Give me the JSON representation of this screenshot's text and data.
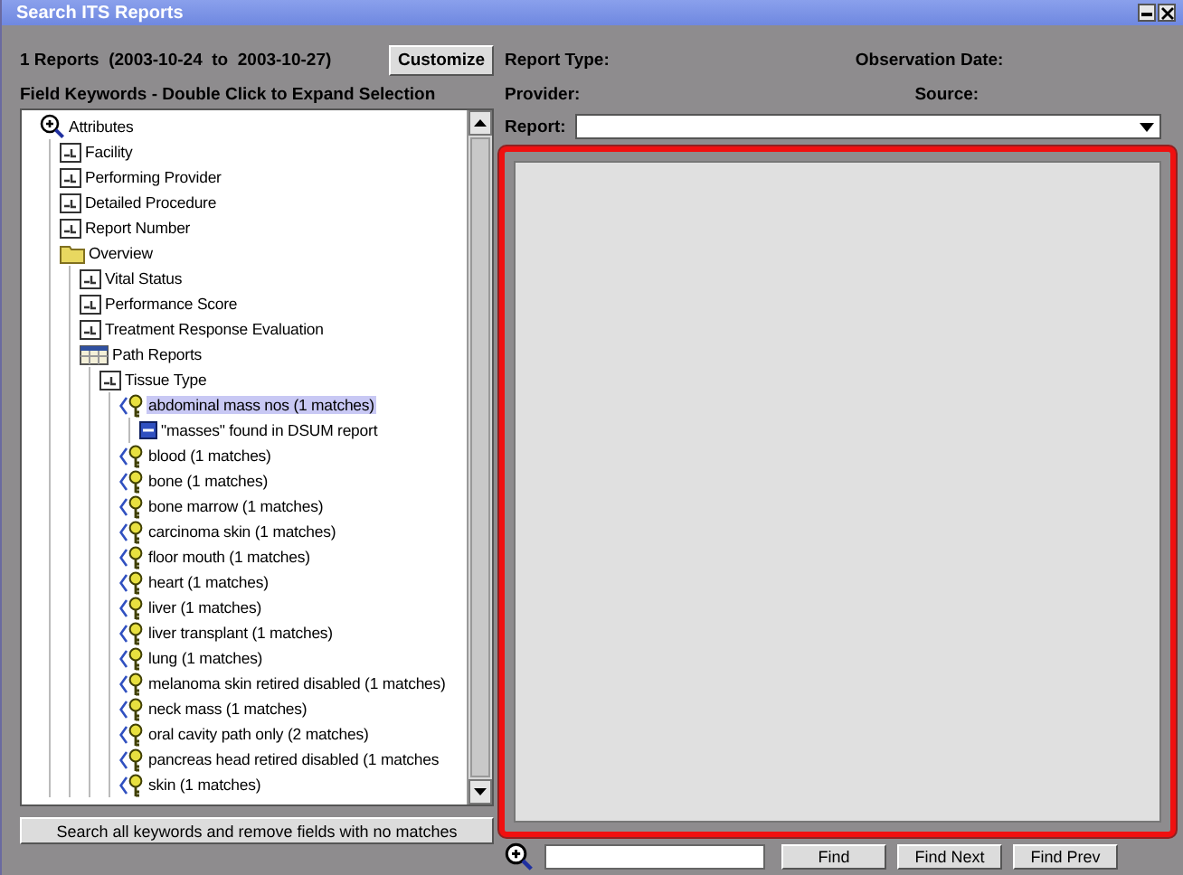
{
  "window": {
    "title": "Search ITS Reports"
  },
  "summary": {
    "text": "1 Reports  (2003-10-24  to  2003-10-27)",
    "customize_button": "Customize"
  },
  "field_keywords": {
    "heading": "Field Keywords - Double Click to Expand Selection",
    "tree": [
      {
        "label": "Attributes",
        "kind": "search",
        "selected": false,
        "children": [
          {
            "label": "Facility",
            "kind": "field",
            "selected": false
          },
          {
            "label": "Performing Provider",
            "kind": "field",
            "selected": false
          },
          {
            "label": "Detailed Procedure",
            "kind": "field",
            "selected": false
          },
          {
            "label": "Report Number",
            "kind": "field",
            "selected": false
          },
          {
            "label": "Overview",
            "kind": "folder",
            "selected": false,
            "children": [
              {
                "label": "Vital Status",
                "kind": "field",
                "selected": false
              },
              {
                "label": "Performance Score",
                "kind": "field",
                "selected": false
              },
              {
                "label": "Treatment Response Evaluation",
                "kind": "field",
                "selected": false
              },
              {
                "label": "Path Reports",
                "kind": "table",
                "selected": false,
                "children": [
                  {
                    "label": "Tissue Type",
                    "kind": "field",
                    "selected": false,
                    "children": [
                      {
                        "label": "abdominal mass nos (1 matches)",
                        "kind": "keyword",
                        "selected": true,
                        "children": [
                          {
                            "label": "\"masses\" found in DSUM report",
                            "kind": "found",
                            "selected": false
                          }
                        ]
                      },
                      {
                        "label": "blood (1 matches)",
                        "kind": "keyword",
                        "selected": false
                      },
                      {
                        "label": "bone (1 matches)",
                        "kind": "keyword",
                        "selected": false
                      },
                      {
                        "label": "bone marrow (1 matches)",
                        "kind": "keyword",
                        "selected": false
                      },
                      {
                        "label": "carcinoma skin (1 matches)",
                        "kind": "keyword",
                        "selected": false
                      },
                      {
                        "label": "floor mouth (1 matches)",
                        "kind": "keyword",
                        "selected": false
                      },
                      {
                        "label": "heart (1 matches)",
                        "kind": "keyword",
                        "selected": false
                      },
                      {
                        "label": "liver (1 matches)",
                        "kind": "keyword",
                        "selected": false
                      },
                      {
                        "label": "liver transplant (1 matches)",
                        "kind": "keyword",
                        "selected": false
                      },
                      {
                        "label": "lung (1 matches)",
                        "kind": "keyword",
                        "selected": false
                      },
                      {
                        "label": "melanoma skin retired disabled (1 matches)",
                        "kind": "keyword",
                        "selected": false
                      },
                      {
                        "label": "neck mass (1 matches)",
                        "kind": "keyword",
                        "selected": false
                      },
                      {
                        "label": "oral cavity path only (2 matches)",
                        "kind": "keyword",
                        "selected": false
                      },
                      {
                        "label": "pancreas head retired disabled (1 matches",
                        "kind": "keyword",
                        "selected": false
                      },
                      {
                        "label": "skin (1 matches)",
                        "kind": "keyword",
                        "selected": false
                      }
                    ]
                  }
                ]
              }
            ]
          }
        ]
      }
    ],
    "search_button": "Search all keywords and remove fields with no matches"
  },
  "report_info": {
    "report_type_label": "Report Type:",
    "observation_date_label": "Observation Date:",
    "provider_label": "Provider:",
    "source_label": "Source:",
    "report_label": "Report:"
  },
  "find_bar": {
    "buttons": [
      "Find",
      "Find Next",
      "Find Prev"
    ]
  }
}
